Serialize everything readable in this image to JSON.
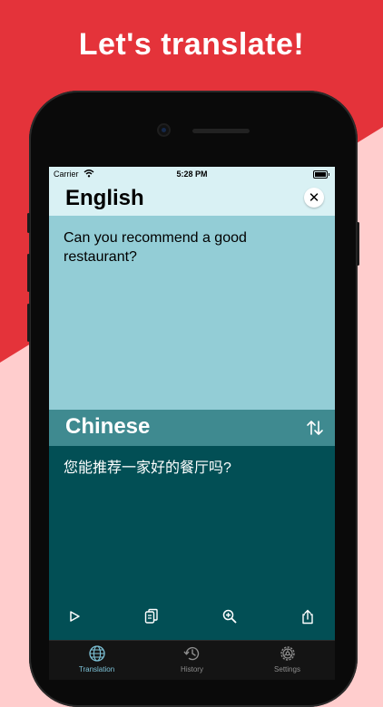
{
  "headline": "Let's translate!",
  "status_bar": {
    "carrier": "Carrier",
    "time": "5:28 PM"
  },
  "source": {
    "language": "English",
    "text": "Can you recommend a good restaurant?",
    "close_icon": "✕"
  },
  "target": {
    "language": "Chinese",
    "text": "您能推荐一家好的餐厅吗?"
  },
  "actions": [
    "play-icon",
    "copy-icon",
    "zoom-in-icon",
    "share-icon"
  ],
  "tabs": [
    {
      "label": "Translation",
      "icon": "globe-icon",
      "active": true
    },
    {
      "label": "History",
      "icon": "history-icon",
      "active": false
    },
    {
      "label": "Settings",
      "icon": "gear-icon",
      "active": false
    }
  ],
  "colors": {
    "promo_red": "#e4333a",
    "promo_pink": "#ffcdcd",
    "source_header": "#d9f1f4",
    "source_body": "#93cdd6",
    "target_header": "#3f8a90",
    "target_body": "#024f55",
    "tab_active": "#7ec3d8"
  }
}
